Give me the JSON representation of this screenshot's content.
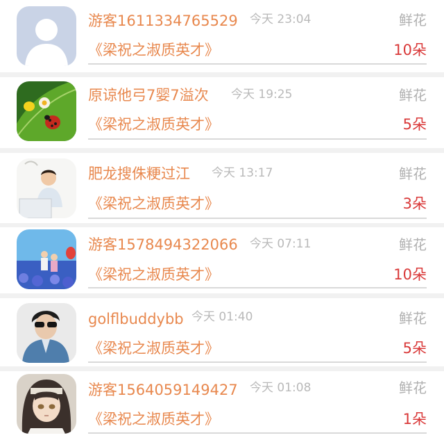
{
  "gifts": [
    {
      "username": "游客1611334765529",
      "time": "今天 23:04",
      "gift_label": "鲜花",
      "book_title": "《梁祝之淑质英才》",
      "count": "10朵",
      "avatar_icon": "default-user-avatar-icon"
    },
    {
      "username": "原谅他弓7婴7溢次",
      "time": "今天 19:25",
      "gift_label": "鲜花",
      "book_title": "《梁祝之淑质英才》",
      "count": "5朵",
      "avatar_icon": "ladybug-leaf-avatar-icon"
    },
    {
      "username": "肥龙搜侏粳过江",
      "time": "今天 13:17",
      "gift_label": "鲜花",
      "book_title": "《梁祝之淑质英才》",
      "count": "3朵",
      "avatar_icon": "man-at-laptop-avatar-icon"
    },
    {
      "username": "游客1578494322066",
      "time": "今天 07:11",
      "gift_label": "鲜花",
      "book_title": "《梁祝之淑质英才》",
      "count": "10朵",
      "avatar_icon": "couple-flowers-avatar-icon"
    },
    {
      "username": "golflbuddybb",
      "time": "今天 01:40",
      "gift_label": "鲜花",
      "book_title": "《梁祝之淑质英才》",
      "count": "5朵",
      "avatar_icon": "man-sunglasses-avatar-icon"
    },
    {
      "username": "游客1564059149427",
      "time": "今天 01:08",
      "gift_label": "鲜花",
      "book_title": "《梁祝之淑质英才》",
      "count": "1朵",
      "avatar_icon": "anime-character-avatar-icon"
    }
  ],
  "colors": {
    "accent": "#e8884e",
    "count_red": "#d93838",
    "muted": "#b9b9b9",
    "divider": "#d9d9d9",
    "background": "#f1f1f1"
  }
}
